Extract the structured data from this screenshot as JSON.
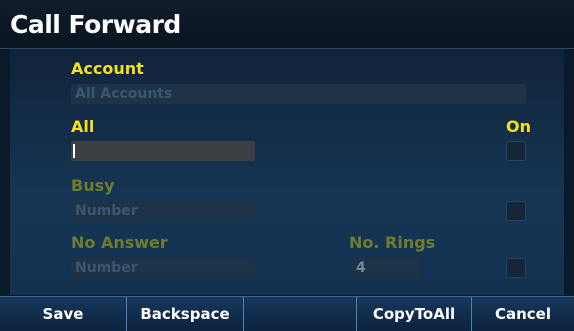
{
  "title": "Call Forward",
  "account": {
    "label": "Account",
    "value": "All Accounts"
  },
  "all": {
    "label": "All",
    "value": "",
    "toggle_label": "On"
  },
  "busy": {
    "label": "Busy",
    "placeholder": "Number"
  },
  "no_answer": {
    "label": "No Answer",
    "placeholder": "Number"
  },
  "no_rings": {
    "label": "No. Rings",
    "value": "4"
  },
  "softkeys": {
    "k1": "Save",
    "k2": "Backspace",
    "k3": "",
    "k4": "CopyToAll",
    "k5": "Cancel"
  }
}
